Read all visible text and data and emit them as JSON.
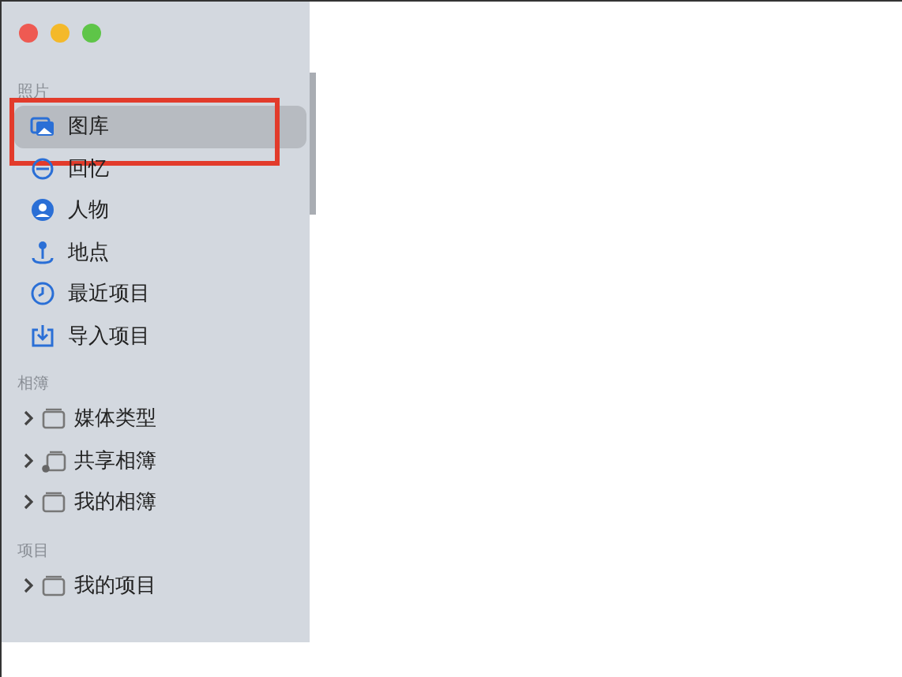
{
  "sidebar": {
    "sections": [
      {
        "title": "照片",
        "items": [
          {
            "label": "图库",
            "kind": "library",
            "selected": true
          },
          {
            "label": "回忆",
            "kind": "memories",
            "selected": false
          },
          {
            "label": "人物",
            "kind": "people",
            "selected": false
          },
          {
            "label": "地点",
            "kind": "places",
            "selected": false
          },
          {
            "label": "最近项目",
            "kind": "recent",
            "selected": false
          },
          {
            "label": "导入项目",
            "kind": "import",
            "selected": false
          }
        ]
      },
      {
        "title": "相簿",
        "items": [
          {
            "label": "媒体类型",
            "kind": "folder",
            "expanded": false
          },
          {
            "label": "共享相簿",
            "kind": "shared",
            "expanded": false
          },
          {
            "label": "我的相簿",
            "kind": "folder",
            "expanded": false
          }
        ]
      },
      {
        "title": "项目",
        "items": [
          {
            "label": "我的项目",
            "kind": "folder",
            "expanded": false
          }
        ]
      }
    ]
  }
}
